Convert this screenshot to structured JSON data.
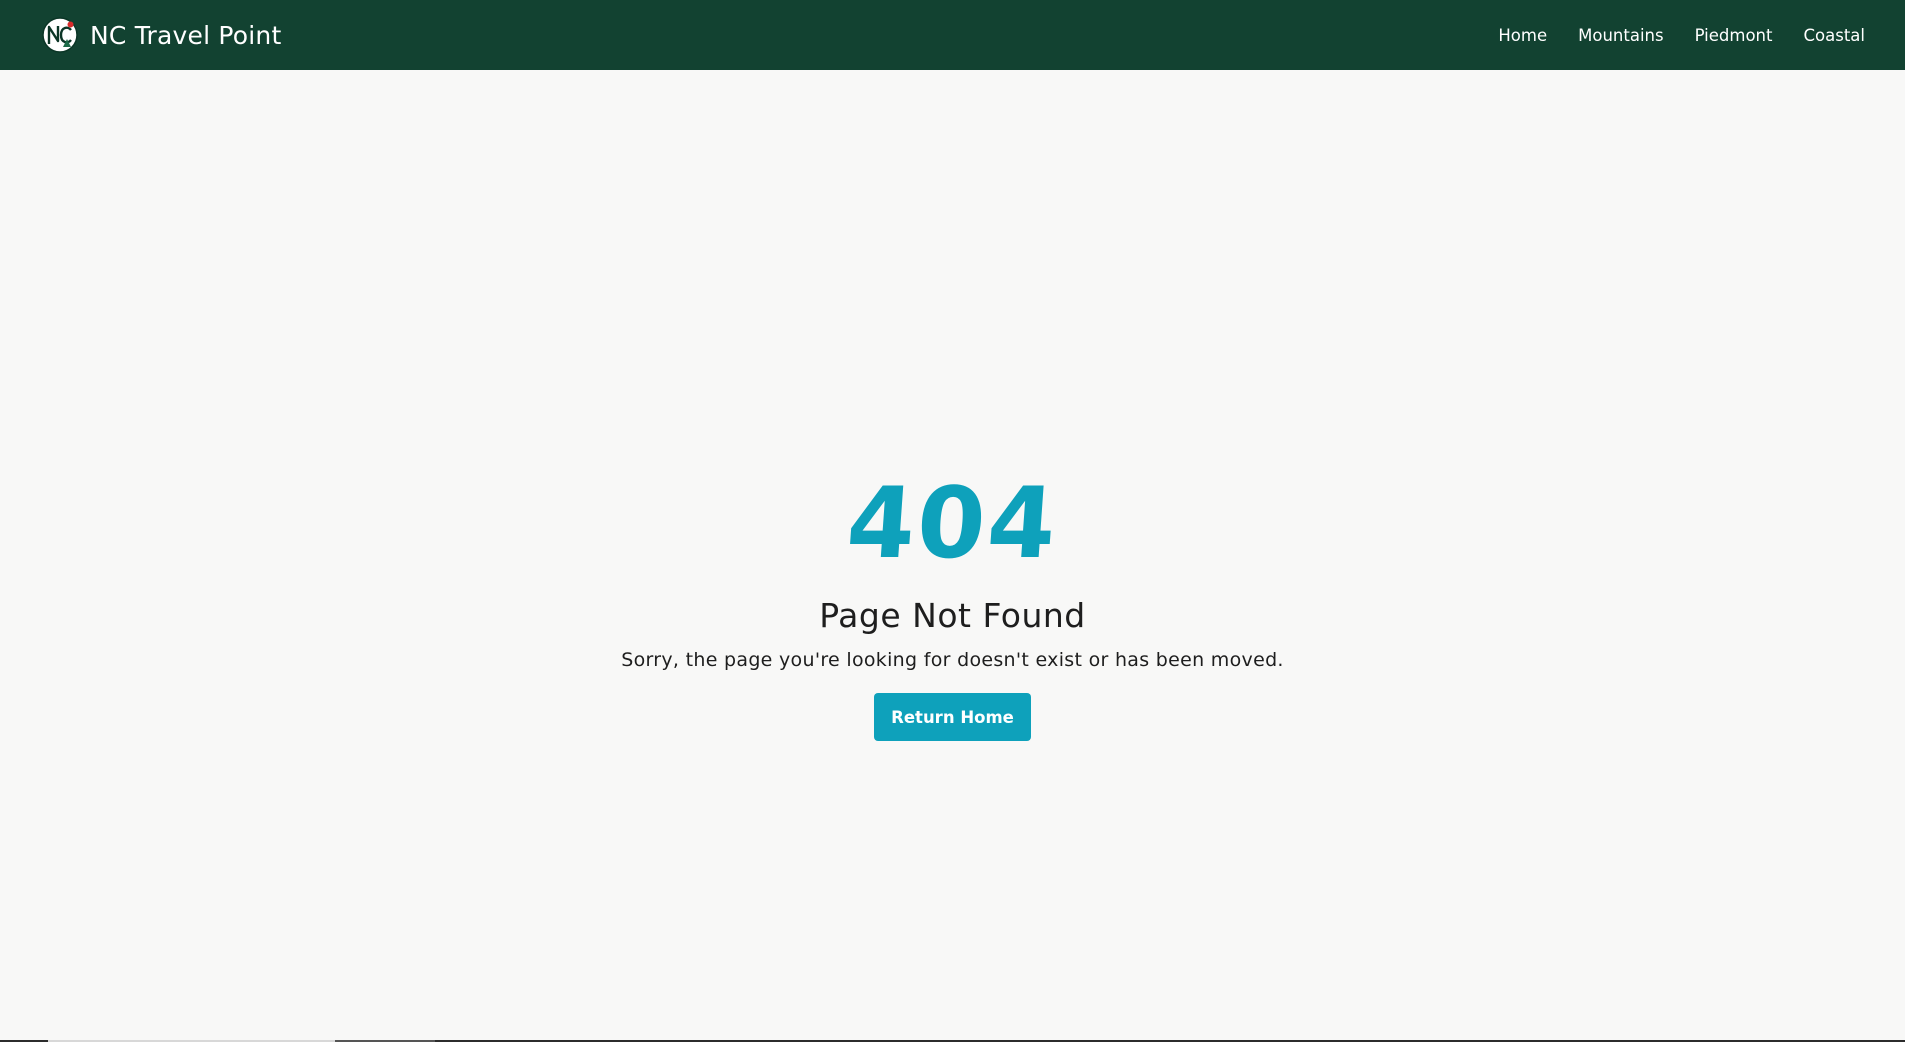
{
  "brand": {
    "name": "NC Travel Point",
    "logo_icon": "nc-logo-icon"
  },
  "nav": {
    "items": [
      {
        "label": "Home"
      },
      {
        "label": "Mountains"
      },
      {
        "label": "Piedmont"
      },
      {
        "label": "Coastal"
      }
    ]
  },
  "error": {
    "code": "404",
    "title": "Page Not Found",
    "message": "Sorry, the page you're looking for doesn't exist or has been moved.",
    "button_label": "Return Home"
  },
  "colors": {
    "navbar_bg": "#124231",
    "accent": "#0ea1bb",
    "page_bg": "#f8f8f7",
    "text": "#1e1e1e"
  }
}
